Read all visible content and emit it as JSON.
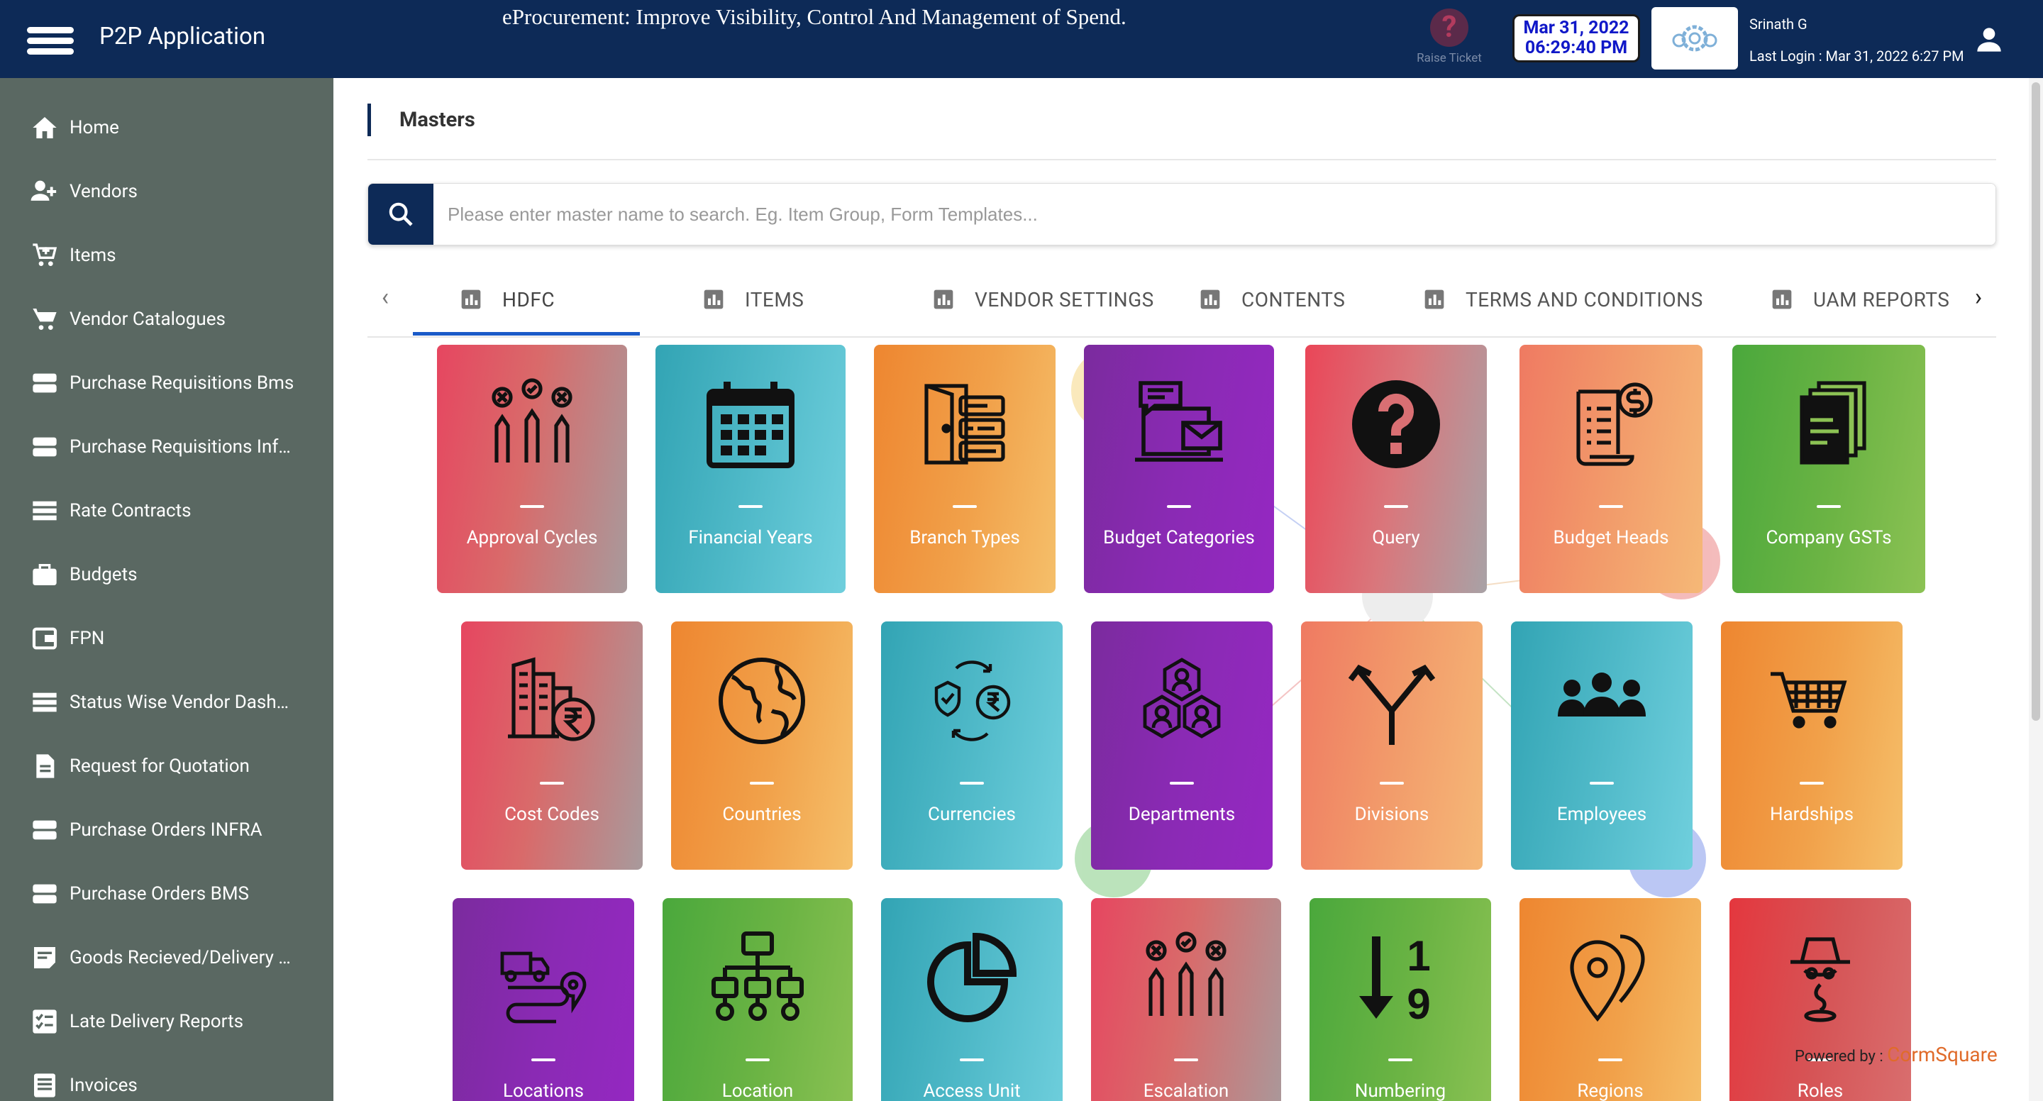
{
  "header": {
    "app_title": "P2P Application",
    "banner": "eProcurement: Improve Visibility, Control And Management of Spend.",
    "raise_ticket": "Raise Ticket",
    "date": "Mar 31, 2022",
    "time": "06:29:40 PM",
    "user_name": "Srinath G",
    "last_login": "Last Login : Mar 31, 2022 6:27 PM"
  },
  "sidebar": {
    "items": [
      {
        "label": "Home",
        "icon": "home-icon"
      },
      {
        "label": "Vendors",
        "icon": "add-user-icon"
      },
      {
        "label": "Items",
        "icon": "cart-add-icon"
      },
      {
        "label": "Vendor Catalogues",
        "icon": "cart-icon"
      },
      {
        "label": "Purchase Requisitions Bms",
        "icon": "storage-icon"
      },
      {
        "label": "Purchase Requisitions Inf…",
        "icon": "storage-icon"
      },
      {
        "label": "Rate Contracts",
        "icon": "list-icon"
      },
      {
        "label": "Budgets",
        "icon": "briefcase-icon"
      },
      {
        "label": "FPN",
        "icon": "wallet-icon"
      },
      {
        "label": "Status Wise Vendor Dash…",
        "icon": "list-icon"
      },
      {
        "label": "Request for Quotation",
        "icon": "document-icon"
      },
      {
        "label": "Purchase Orders INFRA",
        "icon": "storage-icon"
      },
      {
        "label": "Purchase Orders BMS",
        "icon": "storage-icon"
      },
      {
        "label": "Goods Recieved/Delivery …",
        "icon": "note-icon"
      },
      {
        "label": "Late Delivery Reports",
        "icon": "checklist-icon"
      },
      {
        "label": "Invoices",
        "icon": "invoice-icon"
      }
    ]
  },
  "main": {
    "title": "Masters",
    "search_placeholder": "Please enter master name to search. Eg. Item Group, Form Templates...",
    "tabs": [
      "HDFC",
      "ITEMS",
      "VENDOR SETTINGS",
      "CONTENTS",
      "TERMS AND CONDITIONS",
      "UAM REPORTS"
    ],
    "active_tab": "HDFC",
    "tiles": [
      {
        "label": "Approval Cycles",
        "icon": "vote-hands-icon"
      },
      {
        "label": "Financial Years",
        "icon": "calendar-icon"
      },
      {
        "label": "Branch Types",
        "icon": "door-code-icon"
      },
      {
        "label": "Budget Categories",
        "icon": "laptop-chat-mail-icon"
      },
      {
        "label": "Query",
        "icon": "question-circle-icon"
      },
      {
        "label": "Budget Heads",
        "icon": "bill-dollar-icon"
      },
      {
        "label": "Company GSTs",
        "icon": "document-stack-icon"
      },
      {
        "label": "Cost Codes",
        "icon": "building-rupee-icon"
      },
      {
        "label": "Countries",
        "icon": "globe-icon"
      },
      {
        "label": "Currencies",
        "icon": "currency-exchange-icon"
      },
      {
        "label": "Departments",
        "icon": "hexagon-people-icon"
      },
      {
        "label": "Divisions",
        "icon": "split-arrow-icon"
      },
      {
        "label": "Employees",
        "icon": "people-group-icon"
      },
      {
        "label": "Hardships",
        "icon": "shopping-cart-icon"
      },
      {
        "label": "Locations",
        "icon": "truck-route-icon"
      },
      {
        "label": "Location",
        "icon": "hierarchy-icon"
      },
      {
        "label": "Access Unit",
        "icon": "pie-chart-icon"
      },
      {
        "label": "Escalation",
        "icon": "vote-hands-icon"
      },
      {
        "label": "Numbering",
        "icon": "sort-numeric-icon"
      },
      {
        "label": "Regions",
        "icon": "map-pins-icon"
      },
      {
        "label": "Roles",
        "icon": "spy-icon"
      }
    ]
  },
  "footer": {
    "powered_by": "Powered by :",
    "brand": "CormSquare"
  },
  "colors": {
    "header": "#0d2a57",
    "sidebar": "#5a6862",
    "active_tab_ink": "#1a5ac8"
  }
}
